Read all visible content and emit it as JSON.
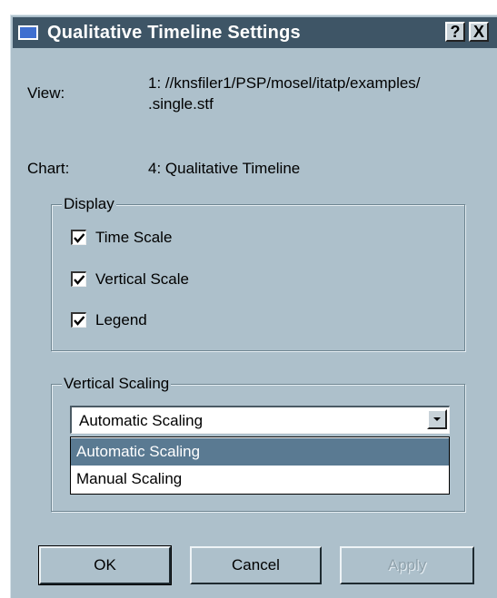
{
  "window": {
    "title": "Qualitative Timeline Settings",
    "help_button": "?",
    "close_button": "X"
  },
  "info": {
    "view_label": "View:",
    "view_value_line1": "1: //knsfiler1/PSP/mosel/itatp/examples/",
    "view_value_line2": ".single.stf",
    "chart_label": "Chart:",
    "chart_value": "4: Qualitative Timeline"
  },
  "display": {
    "title": "Display",
    "items": [
      {
        "label": "Time Scale",
        "checked": true
      },
      {
        "label": "Vertical Scale",
        "checked": true
      },
      {
        "label": "Legend",
        "checked": true
      }
    ]
  },
  "vertical_scaling": {
    "title": "Vertical Scaling",
    "selected": "Automatic Scaling",
    "options": [
      "Automatic Scaling",
      "Manual Scaling"
    ],
    "highlighted_index": 0
  },
  "buttons": {
    "ok": "OK",
    "cancel": "Cancel",
    "apply": "Apply"
  },
  "colors": {
    "dialog_bg": "#adc0cb",
    "titlebar_bg": "#3e5566",
    "selection_bg": "#5a7a92"
  }
}
